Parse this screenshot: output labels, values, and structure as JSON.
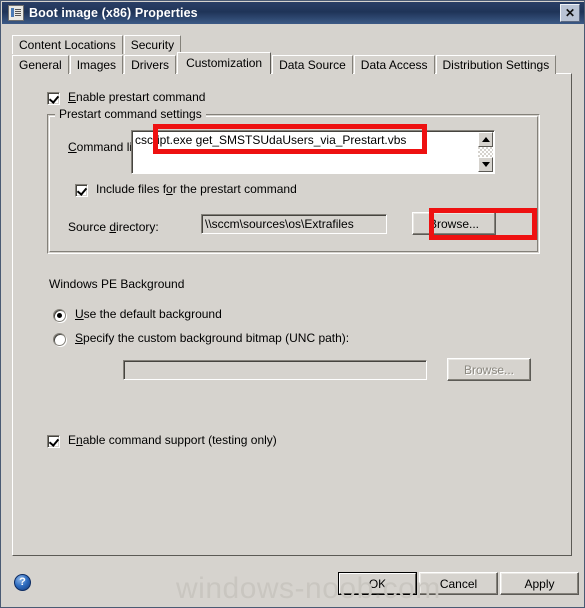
{
  "window": {
    "title": "Boot image (x86) Properties",
    "title_icon": "document-properties-icon",
    "close_label": "✕"
  },
  "tabs": {
    "row1": [
      {
        "label": "Content Locations",
        "active": false
      },
      {
        "label": "Security",
        "active": false
      }
    ],
    "row2": [
      {
        "label": "General",
        "active": false
      },
      {
        "label": "Images",
        "active": false
      },
      {
        "label": "Drivers",
        "active": false
      },
      {
        "label": "Customization",
        "active": true
      },
      {
        "label": "Data Source",
        "active": false
      },
      {
        "label": "Data Access",
        "active": false
      },
      {
        "label": "Distribution Settings",
        "active": false
      }
    ],
    "selected": "Customization"
  },
  "main": {
    "enable_prestart": {
      "label": "Enable prestart command",
      "checked": true
    },
    "prestart_group": {
      "title": "Prestart command settings",
      "command_line_label": "Command line:",
      "command_line_value": "cscript.exe get_SMSTSUdaUsers_via_Prestart.vbs",
      "include_files": {
        "label": "Include files for the prestart command",
        "checked": true
      },
      "source_directory_label": "Source directory:",
      "source_directory_value": "\\\\sccm\\sources\\os\\Extrafiles",
      "browse_label": "Browse...",
      "scroll_up_icon": "scroll-up-arrow-icon",
      "scroll_down_icon": "scroll-down-arrow-icon"
    },
    "winpe_background": {
      "heading": "Windows PE Background",
      "option_default": {
        "label": "Use the default background",
        "selected": true
      },
      "option_custom": {
        "label": "Specify the custom background bitmap (UNC path):",
        "selected": false
      },
      "custom_path_value": "",
      "custom_path_placeholder": "",
      "browse_label": "Browse...",
      "browse_disabled": true
    },
    "enable_command_support": {
      "label": "Enable command support (testing only)",
      "checked": true
    }
  },
  "footer": {
    "help_icon": "help-question-icon",
    "help_glyph": "?",
    "ok_label": "OK",
    "cancel_label": "Cancel",
    "apply_label": "Apply"
  },
  "watermark": {
    "text": "windows-noob.com"
  },
  "colors": {
    "dialog_face": "#d6d3ce",
    "titlebar": "#1f3458",
    "annotation_red": "#ee1111",
    "help_blue": "#2f6dc0",
    "watermark_gray": "#c9c6c0"
  }
}
